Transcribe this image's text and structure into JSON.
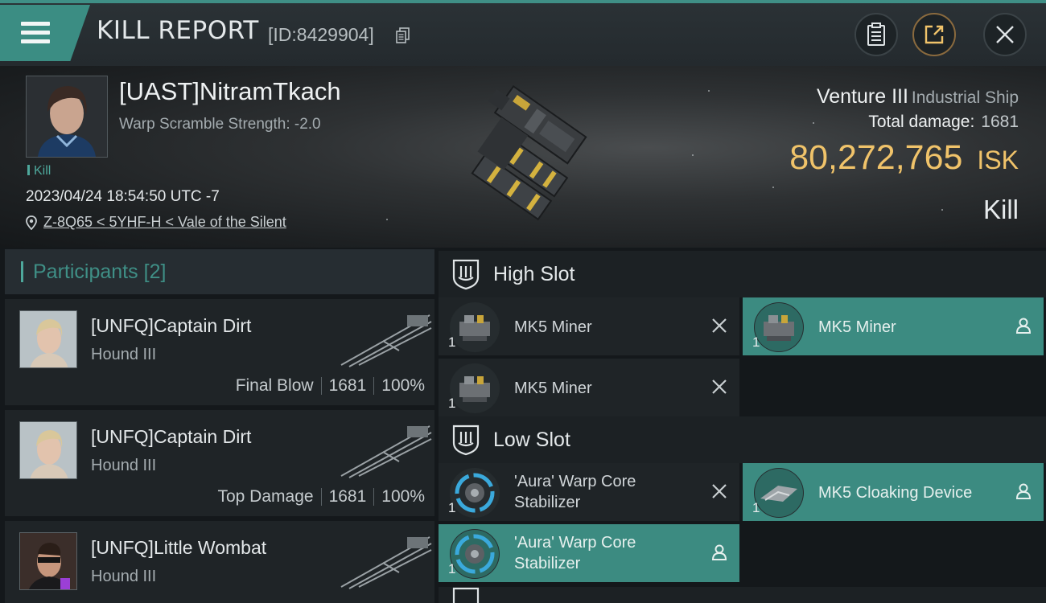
{
  "header": {
    "title": "KILL REPORT",
    "report_id": "[ID:8429904]"
  },
  "victim": {
    "name": "[UAST]NitramTkach",
    "warp_scramble": "Warp Scramble Strength: -2.0",
    "kill_tag": "Kill",
    "datetime": "2023/04/24 18:54:50 UTC -7",
    "location": "Z-8Q65 < 5YHF-H < Vale of the Silent",
    "ship_name": "Venture III",
    "ship_class": "Industrial Ship",
    "total_damage_label": "Total damage:",
    "total_damage_value": "1681",
    "isk_value": "80,272,765",
    "isk_currency": "ISK",
    "result": "Kill"
  },
  "participants": {
    "label": "Participants",
    "count": "[2]",
    "rows": [
      {
        "name": "[UNFQ]Captain Dirt",
        "ship": "Hound III",
        "stat_label": "Final Blow",
        "damage": "1681",
        "percent": "100%"
      },
      {
        "name": "[UNFQ]Captain Dirt",
        "ship": "Hound III",
        "stat_label": "Top Damage",
        "damage": "1681",
        "percent": "100%"
      },
      {
        "name": "[UNFQ]Little Wombat",
        "ship": "Hound III"
      }
    ]
  },
  "fitting": {
    "high_slot": {
      "label": "High Slot",
      "modules": [
        {
          "name": "MK5 Miner",
          "qty": "1",
          "status": "destroyed"
        },
        {
          "name": "MK5 Miner",
          "qty": "1",
          "status": "dropped"
        },
        {
          "name": "MK5 Miner",
          "qty": "1",
          "status": "destroyed"
        }
      ]
    },
    "low_slot": {
      "label": "Low Slot",
      "modules": [
        {
          "name": "'Aura' Warp Core Stabilizer",
          "qty": "1",
          "status": "destroyed"
        },
        {
          "name": "MK5 Cloaking Device",
          "qty": "1",
          "status": "dropped"
        },
        {
          "name": "'Aura' Warp Core Stabilizer",
          "qty": "1",
          "status": "dropped"
        }
      ]
    }
  },
  "colors": {
    "accent_teal": "#3f8f86",
    "isk_gold": "#f0c36a",
    "dropped_bg": "#3c8b81"
  }
}
